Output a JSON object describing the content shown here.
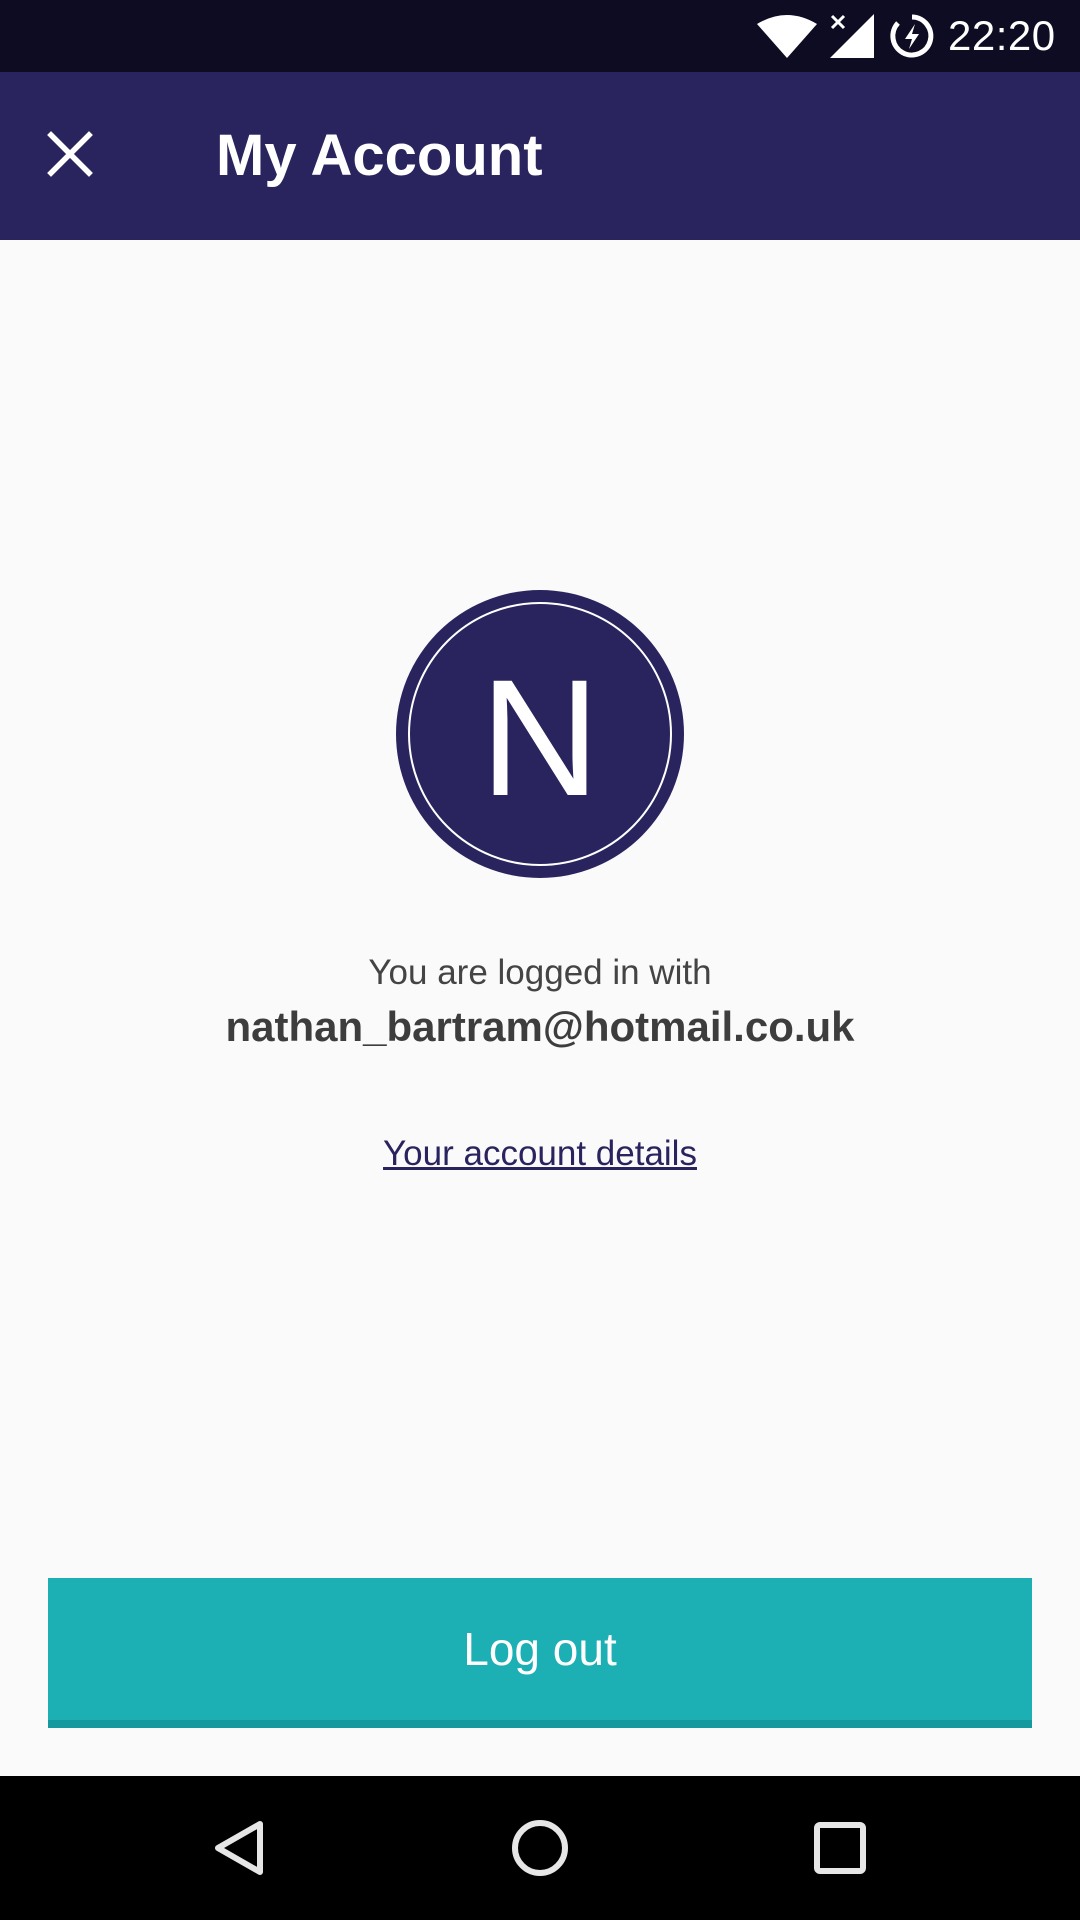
{
  "status_bar": {
    "time": "22:20",
    "icons": [
      "wifi-icon",
      "signal-icon",
      "battery-charging-icon"
    ]
  },
  "toolbar": {
    "title": "My Account",
    "close_icon": "close-icon"
  },
  "account": {
    "avatar_initial": "N",
    "logged_in_label": "You are logged in with",
    "email": "nathan_bartram@hotmail.co.uk",
    "details_link": "Your account details"
  },
  "actions": {
    "logout_label": "Log out"
  },
  "nav_bar": {
    "icons": [
      "back-icon",
      "home-icon",
      "recents-icon"
    ]
  },
  "colors": {
    "primary": "#29245e",
    "status_bar": "#0e0c22",
    "accent": "#1cafb4",
    "background": "#fafafa",
    "text": "#3d3d3d"
  }
}
